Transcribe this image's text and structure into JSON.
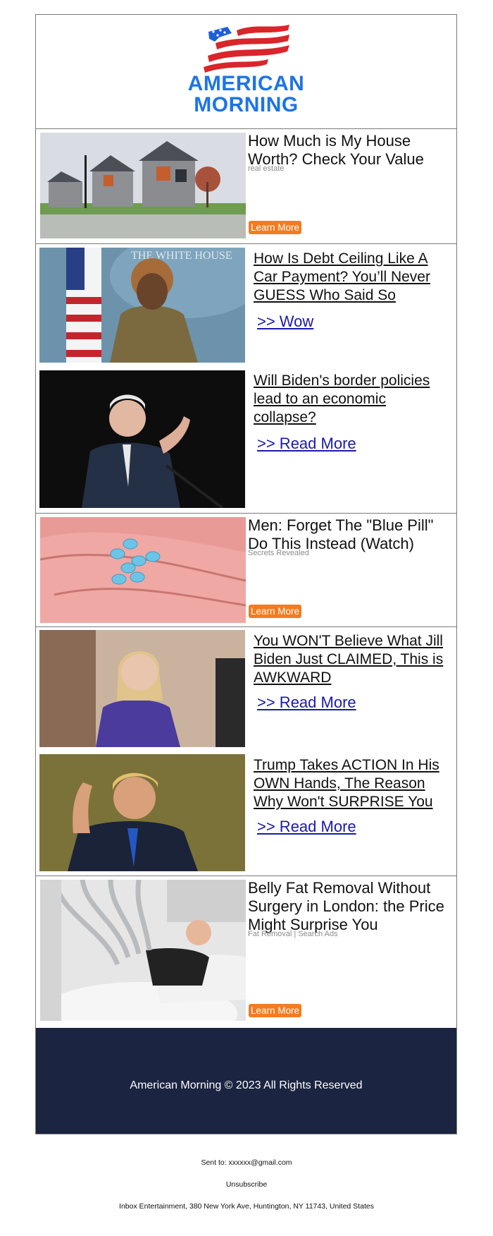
{
  "brand": {
    "line1": "AMERICAN",
    "line2": "MORNING",
    "color": "#1e74e6"
  },
  "ads": [
    {
      "title": "How Much is My House Worth? Check Your Value",
      "category": "real estate",
      "cta": "Learn More",
      "image": "suburban-houses"
    },
    {
      "title": "Men: Forget The \"Blue Pill\" Do This Instead (Watch)",
      "category": "Secrets Revealed",
      "cta": "Learn More",
      "image": "blue-pills-in-hand"
    },
    {
      "title": "Belly Fat Removal Without Surgery in London: the Price Might Surprise You",
      "category": "Fat Removal | Search Ads",
      "cta": "Learn More",
      "image": "clinic-treatment"
    }
  ],
  "articles": [
    {
      "title": "How Is Debt Ceiling Like A Car Payment? You’ll Never GUESS Who Said So",
      "link": ">> Wow",
      "image": "press-briefing"
    },
    {
      "title": "Will Biden's border policies lead to an economic collapse?",
      "link": ">> Read More",
      "image": "speaker-pointing"
    },
    {
      "title": "You WON'T Believe What Jill Biden Just CLAIMED, This is AWKWARD",
      "link": ">> Read More",
      "image": "woman-smiling"
    },
    {
      "title": "Trump Takes ACTION In His OWN Hands, The Reason Why Won't SURPRISE You",
      "link": ">> Read More",
      "image": "man-waving"
    }
  ],
  "footer": {
    "copyright": "American Morning © 2023 All Rights Reserved",
    "background": "#1b2440"
  },
  "meta": {
    "sent_to": "Sent to: xxxxxx@gmail.com",
    "unsubscribe": "Unsubscribe",
    "address": "Inbox Entertainment, 380 New York Ave, Huntington, NY 11743, United States"
  },
  "colors": {
    "cta": "#f47b20",
    "link": "#1a1aaa"
  }
}
